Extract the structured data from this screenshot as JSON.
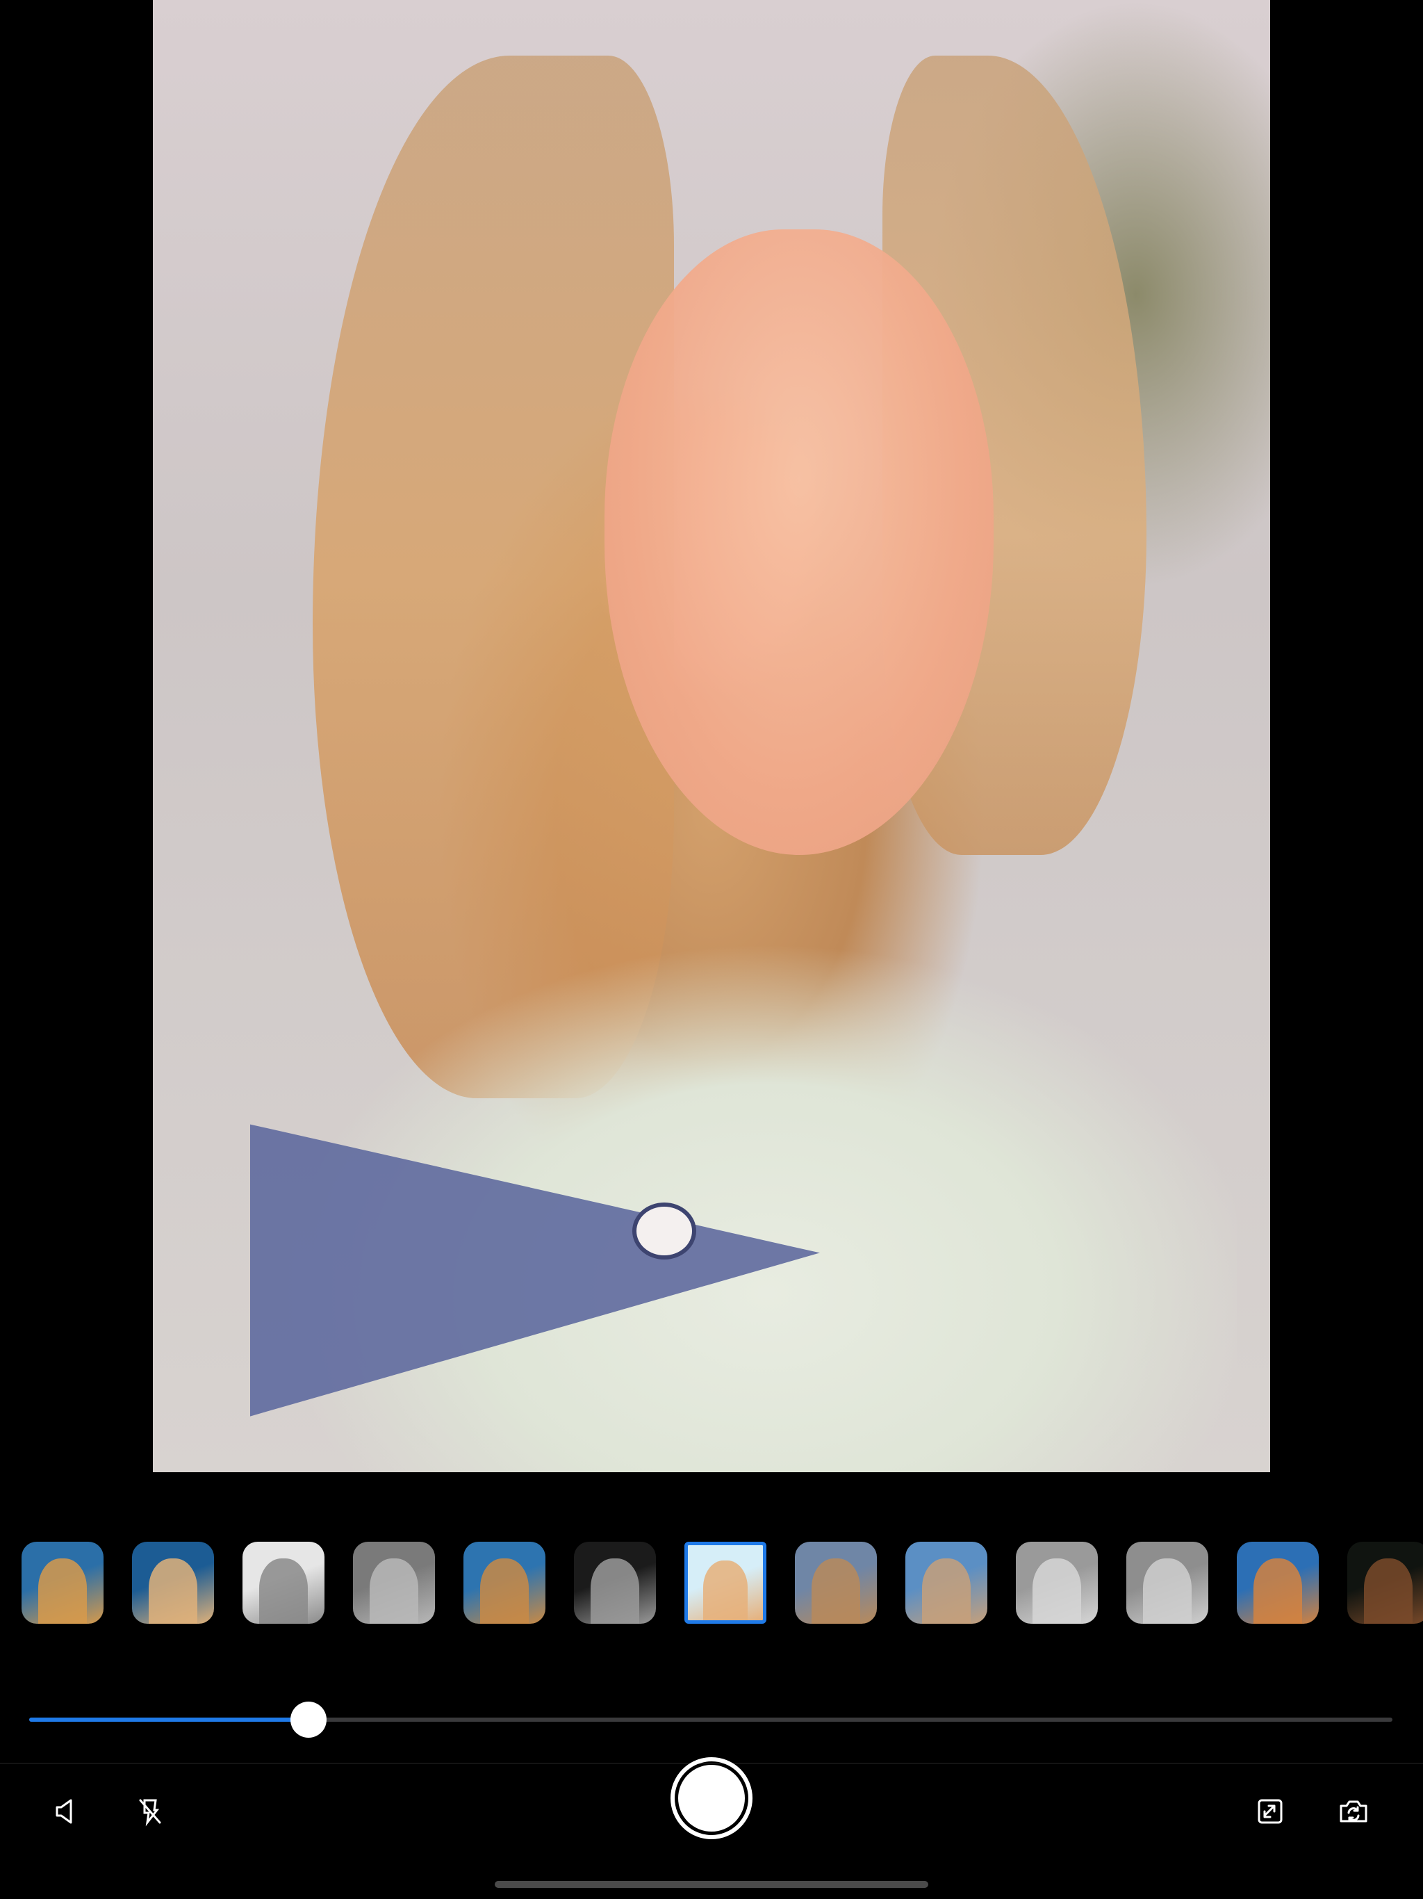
{
  "preview": {
    "filter_applied": "color-edge",
    "palette": {
      "skin": "#f1a98a",
      "hair": "#d9a36a",
      "jacket": "#e3e8dc",
      "lapel": "#5f6a9e",
      "outline": "#7fd3ec"
    }
  },
  "filters": [
    {
      "name": "filter-color-1",
      "selected": false,
      "bg": "#2b6fa8",
      "fg": "#d79a4b"
    },
    {
      "name": "filter-color-2",
      "selected": false,
      "bg": "#1c5c94",
      "fg": "#e1b27a"
    },
    {
      "name": "filter-sketch-bw",
      "selected": false,
      "bg": "#e6e6e6",
      "fg": "#8a8a8a"
    },
    {
      "name": "filter-emboss",
      "selected": false,
      "bg": "#7a7a7a",
      "fg": "#b8b8b8"
    },
    {
      "name": "filter-warm",
      "selected": false,
      "bg": "#2d74b0",
      "fg": "#c98a45"
    },
    {
      "name": "filter-mono-dark",
      "selected": false,
      "bg": "#1b1b1b",
      "fg": "#9a9a9a"
    },
    {
      "name": "filter-color-edge",
      "selected": true,
      "bg": "#d6eef8",
      "fg": "#e6b07a"
    },
    {
      "name": "filter-pixelate",
      "selected": false,
      "bg": "#6f86a6",
      "fg": "#b98a5a"
    },
    {
      "name": "filter-glass",
      "selected": false,
      "bg": "#5b8fc4",
      "fg": "#c7a07a"
    },
    {
      "name": "filter-halftone",
      "selected": false,
      "bg": "#9a9a9a",
      "fg": "#d6d6d6"
    },
    {
      "name": "filter-halftone-2",
      "selected": false,
      "bg": "#8e8e8e",
      "fg": "#cfcfcf"
    },
    {
      "name": "filter-twirl",
      "selected": false,
      "bg": "#2c6fb5",
      "fg": "#d3823f"
    },
    {
      "name": "filter-neon",
      "selected": false,
      "bg": "#101410",
      "fg": "#7a4a2a"
    }
  ],
  "slider": {
    "value_fraction": 0.205
  },
  "toolbar": {
    "left_icons": [
      "volume-icon",
      "flash-off-icon"
    ],
    "right_icons": [
      "share-icon",
      "switch-camera-icon"
    ],
    "icon_color": "#ffffff"
  }
}
